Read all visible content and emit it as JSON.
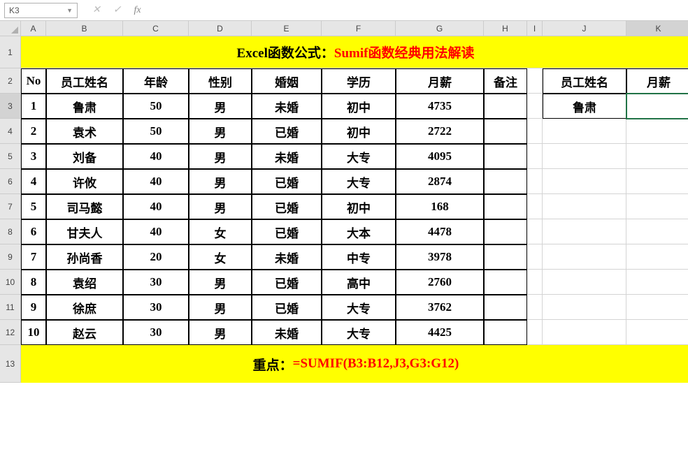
{
  "formula_bar": {
    "name_box": "K3",
    "cancel": "✕",
    "confirm": "✓",
    "fx": "fx",
    "value": ""
  },
  "columns": [
    "A",
    "B",
    "C",
    "D",
    "E",
    "F",
    "G",
    "H",
    "I",
    "J",
    "K"
  ],
  "title": {
    "pre": "Excel函数公式：",
    "red": "Sumif函数经典用法解读"
  },
  "headers": [
    "No",
    "员工姓名",
    "年龄",
    "性别",
    "婚姻",
    "学历",
    "月薪",
    "备注"
  ],
  "side_headers": [
    "员工姓名",
    "月薪"
  ],
  "side_values": [
    "鲁肃",
    ""
  ],
  "rows": [
    {
      "no": "1",
      "name": "鲁肃",
      "age": "50",
      "sex": "男",
      "marry": "未婚",
      "edu": "初中",
      "salary": "4735",
      "note": ""
    },
    {
      "no": "2",
      "name": "袁术",
      "age": "50",
      "sex": "男",
      "marry": "已婚",
      "edu": "初中",
      "salary": "2722",
      "note": ""
    },
    {
      "no": "3",
      "name": "刘备",
      "age": "40",
      "sex": "男",
      "marry": "未婚",
      "edu": "大专",
      "salary": "4095",
      "note": ""
    },
    {
      "no": "4",
      "name": "许攸",
      "age": "40",
      "sex": "男",
      "marry": "已婚",
      "edu": "大专",
      "salary": "2874",
      "note": ""
    },
    {
      "no": "5",
      "name": "司马懿",
      "age": "40",
      "sex": "男",
      "marry": "已婚",
      "edu": "初中",
      "salary": "168",
      "note": ""
    },
    {
      "no": "6",
      "name": "甘夫人",
      "age": "40",
      "sex": "女",
      "marry": "已婚",
      "edu": "大本",
      "salary": "4478",
      "note": ""
    },
    {
      "no": "7",
      "name": "孙尚香",
      "age": "20",
      "sex": "女",
      "marry": "未婚",
      "edu": "中专",
      "salary": "3978",
      "note": ""
    },
    {
      "no": "8",
      "name": "袁绍",
      "age": "30",
      "sex": "男",
      "marry": "已婚",
      "edu": "高中",
      "salary": "2760",
      "note": ""
    },
    {
      "no": "9",
      "name": "徐庶",
      "age": "30",
      "sex": "男",
      "marry": "已婚",
      "edu": "大专",
      "salary": "3762",
      "note": ""
    },
    {
      "no": "10",
      "name": "赵云",
      "age": "30",
      "sex": "男",
      "marry": "未婚",
      "edu": "大专",
      "salary": "4425",
      "note": ""
    }
  ],
  "bottom": {
    "pre": "重点：",
    "red": "=SUMIF(B3:B12,J3,G3:G12)"
  },
  "selected_cell": "K3"
}
